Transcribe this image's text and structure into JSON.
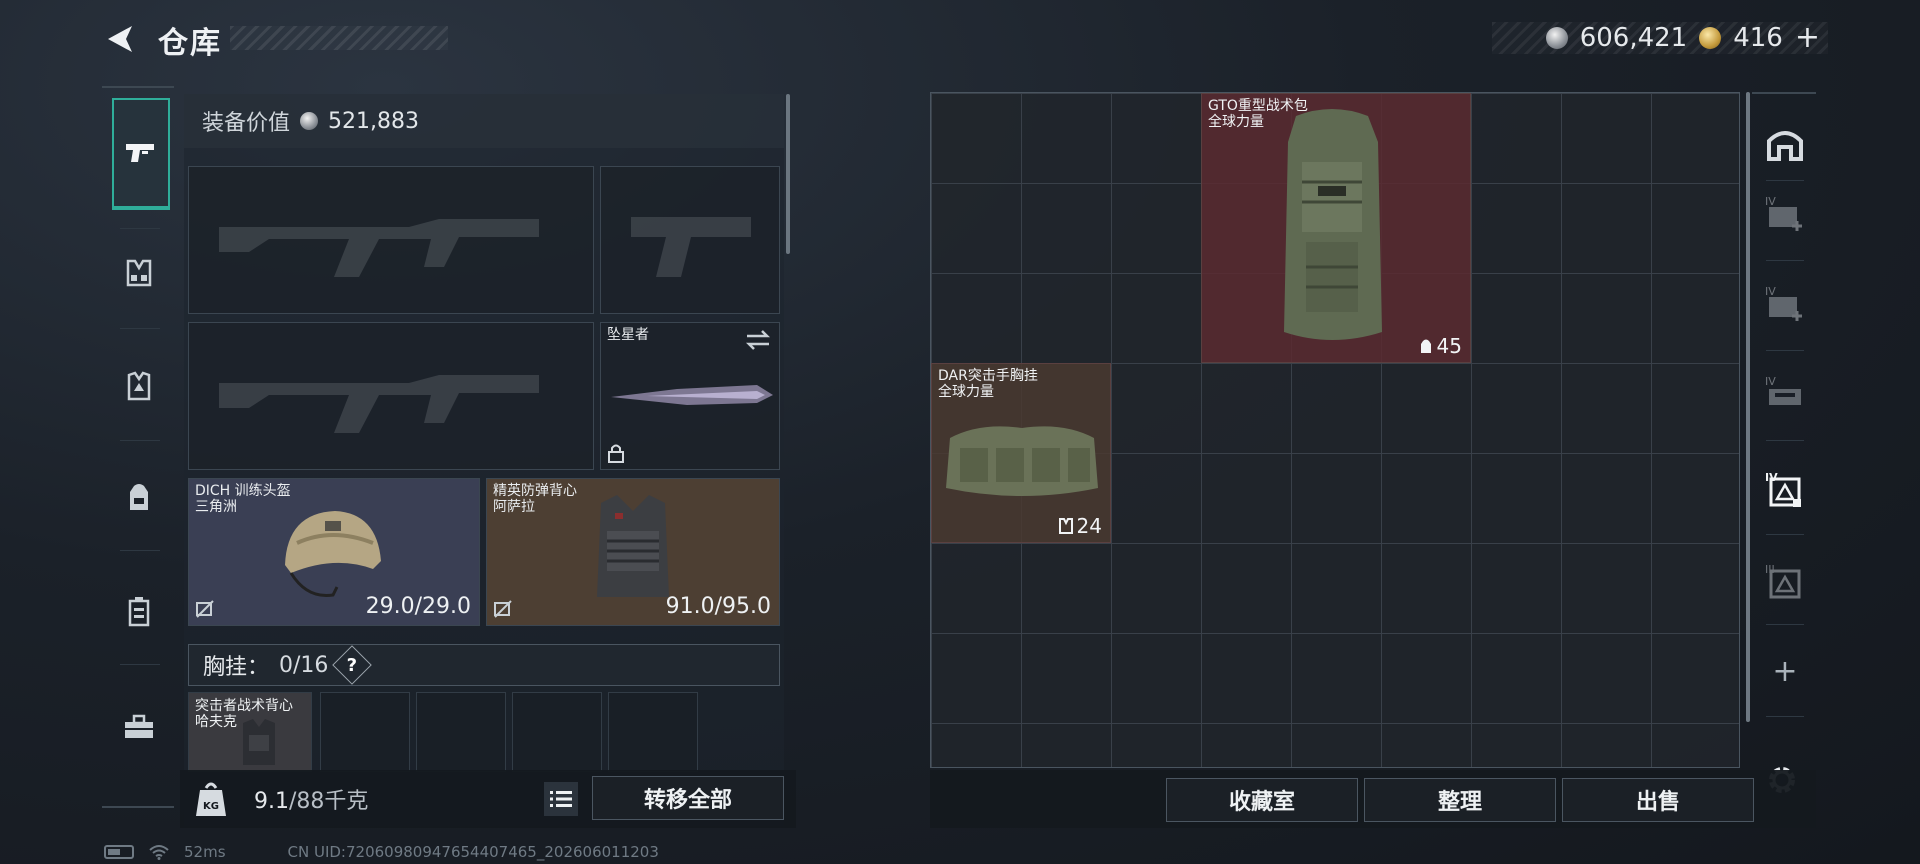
{
  "header": {
    "title": "仓库",
    "currency_silver": "606,421",
    "currency_gold": "416",
    "add_label": "+"
  },
  "left_rail": {
    "items": [
      {
        "name": "pistol-icon",
        "active": true
      },
      {
        "name": "chest-rig-icon",
        "active": false
      },
      {
        "name": "armor-vest-icon",
        "active": false
      },
      {
        "name": "backpack-icon",
        "active": false
      },
      {
        "name": "container-icon",
        "active": false
      },
      {
        "name": "toolbox-icon",
        "active": false
      }
    ]
  },
  "equipment": {
    "value_label": "装备价值",
    "value": "521,883",
    "melee": {
      "name": "坠星者"
    },
    "helmet": {
      "name": "DICH 训练头盔",
      "sub": "三角洲",
      "durability": "29.0/29.0"
    },
    "armor": {
      "name": "精英防弹背心",
      "sub": "阿萨拉",
      "durability": "91.0/95.0"
    },
    "vest_label": "胸挂：",
    "vest_count": "0/16",
    "help": "?",
    "vest_item": {
      "name": "突击者战术背心",
      "sub": "哈夫克"
    }
  },
  "footer_left": {
    "weight_current": "9.1",
    "weight_rest": "/88千克",
    "weight_icon_text": "KG",
    "transfer_all": "转移全部"
  },
  "stash": {
    "backpack": {
      "name": "GTO重型战术包",
      "sub": "全球力量",
      "capacity": "45"
    },
    "chest_rig": {
      "name": "DAR突击手胸挂",
      "sub": "全球力量",
      "capacity": "24"
    }
  },
  "right_rail": {
    "tier_labels": [
      "IV",
      "IV",
      "IV",
      "IV",
      "III"
    ],
    "add": "+"
  },
  "footer_right": {
    "collection": "收藏室",
    "sort": "整理",
    "sell": "出售"
  },
  "status": {
    "ping": "52ms",
    "uid": "CN UID:72060980947654407465_202606011203"
  },
  "colors": {
    "accent": "#2fae9a",
    "backpack_tile": "#5a2a30",
    "rig_tile": "#4a3a30",
    "helmet_tile": "#3a3f54",
    "armor_tile": "#4d3f33"
  }
}
